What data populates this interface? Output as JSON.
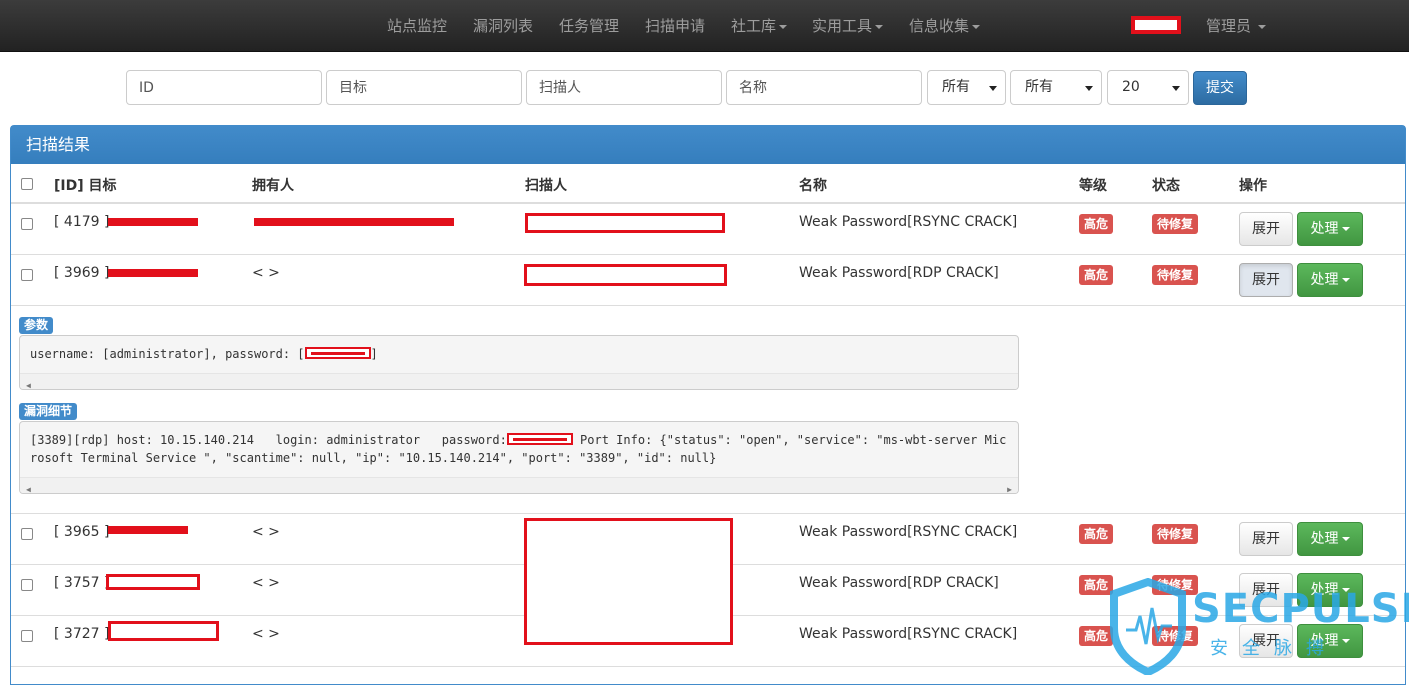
{
  "navbar": {
    "items": [
      "站点监控",
      "漏洞列表",
      "任务管理",
      "扫描申请",
      "社工库",
      "实用工具",
      "信息收集"
    ],
    "user": "管理员"
  },
  "filters": {
    "id_placeholder": "ID",
    "target_placeholder": "目标",
    "scanner_placeholder": "扫描人",
    "name_placeholder": "名称",
    "level_value": "所有",
    "status_value": "所有",
    "page_size": "20",
    "submit_label": "提交"
  },
  "panel": {
    "title": "扫描结果",
    "headers": [
      "[ID] 目标",
      "拥有人",
      "扫描人",
      "名称",
      "等级",
      "状态",
      "操作"
    ]
  },
  "rows": [
    {
      "id": "[ 4179 ]",
      "owner": "",
      "name": "Weak Password[RSYNC CRACK]",
      "level": "高危",
      "status": "待修复",
      "expand": "展开",
      "handle": "处理"
    },
    {
      "id": "[ 3969 ]",
      "owner": "< >",
      "name": "Weak Password[RDP CRACK]",
      "level": "高危",
      "status": "待修复",
      "expand": "展开",
      "handle": "处理"
    },
    {
      "id": "[ 3965 ]",
      "owner": "< >",
      "name": "Weak Password[RSYNC CRACK]",
      "level": "高危",
      "status": "待修复",
      "expand": "展开",
      "handle": "处理"
    },
    {
      "id": "[ 3757 ]",
      "owner": "< >",
      "name": "Weak Password[RDP CRACK]",
      "level": "高危",
      "status": "待修复",
      "expand": "展开",
      "handle": "处理"
    },
    {
      "id": "[ 3727 ]",
      "owner": "< >",
      "name": "Weak Password[RSYNC CRACK]",
      "level": "高危",
      "status": "待修复",
      "expand": "展开",
      "handle": "处理"
    }
  ],
  "detail": {
    "params_label": "参数",
    "params_text_pre": "username: [administrator], password: [",
    "params_text_post": "]",
    "vuln_label": "漏洞细节",
    "vuln_line1_pre": "[3389][rdp] host: 10.15.140.214   login: administrator   password:",
    "vuln_line1_post": " Port Info: {\"status\": \"open\", \"service\": \"ms-wbt-server Mic",
    "vuln_line2": "rosoft Terminal Service \", \"scantime\": null, \"ip\": \"10.15.140.214\", \"port\": \"3389\", \"id\": null}"
  },
  "watermark": {
    "brand": "SECPULSE",
    "sub": "安全脉搏"
  },
  "colors": {
    "navbar": "#222222",
    "primary": "#428bca",
    "danger": "#d9534f",
    "success": "#5cb85c",
    "redaction": "#e2101b",
    "watermark": "#2aa8e6"
  }
}
